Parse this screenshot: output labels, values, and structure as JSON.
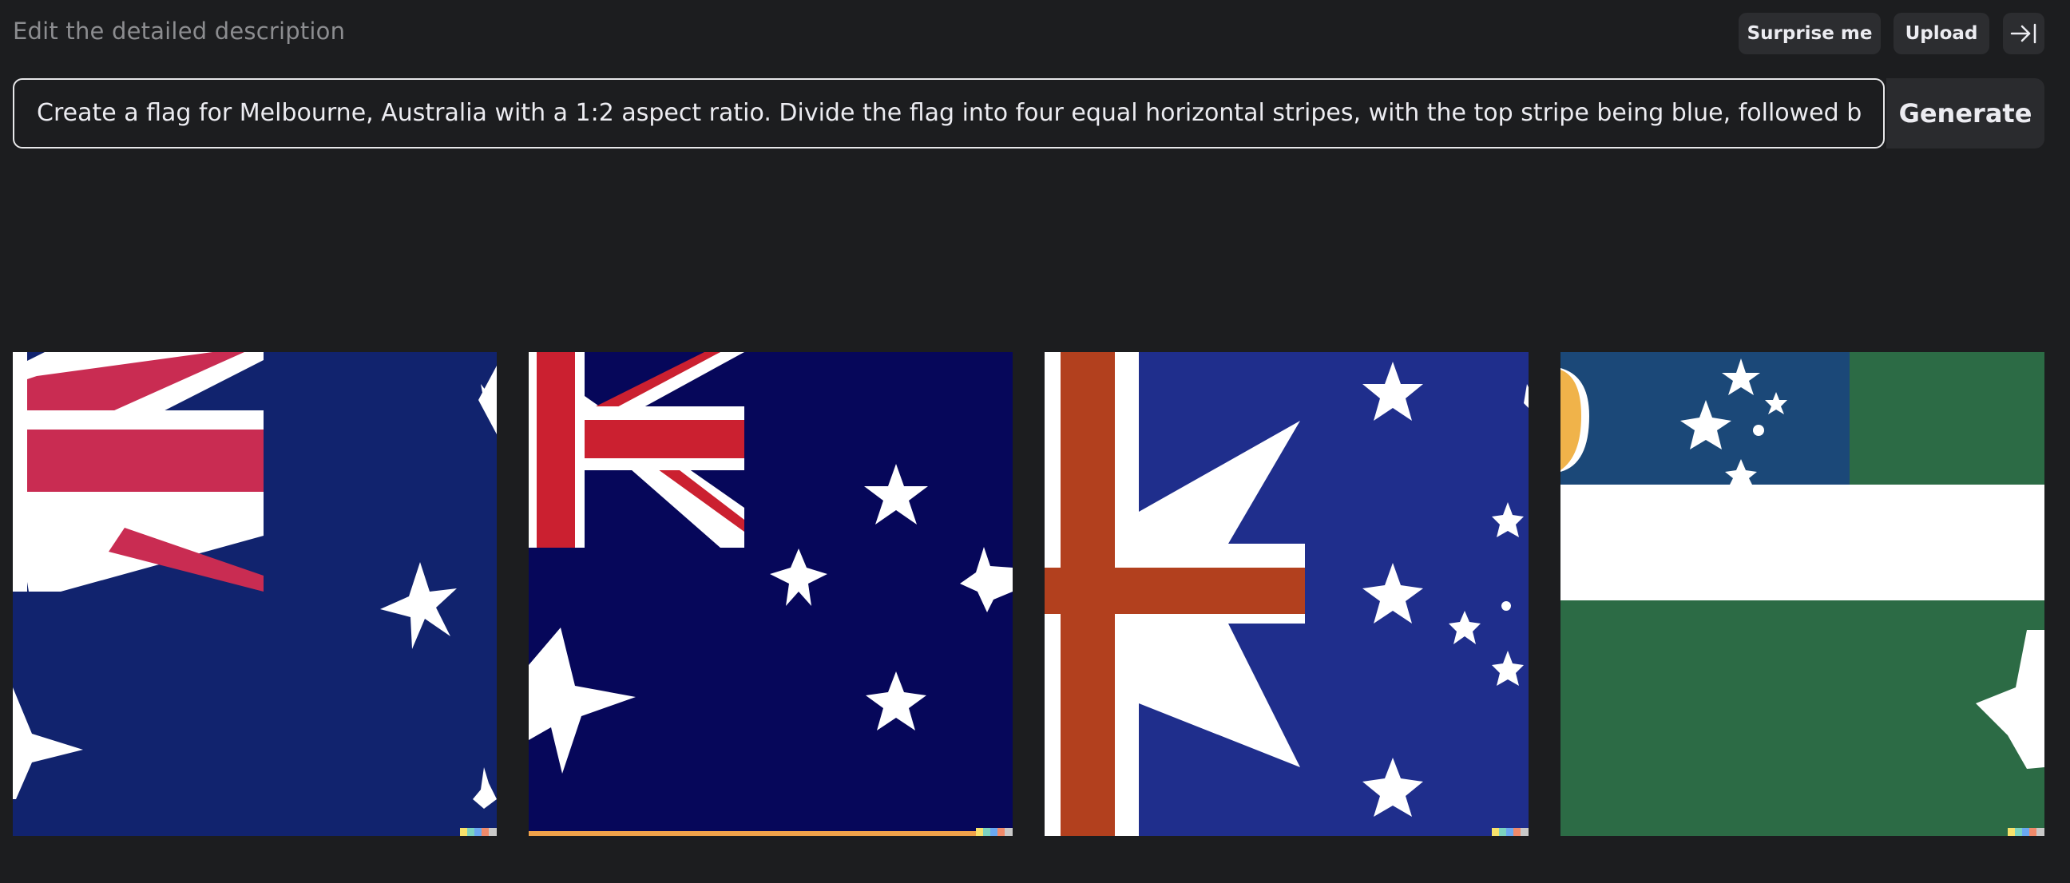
{
  "header": {
    "title": "Edit the detailed description",
    "surprise_label": "Surprise me",
    "upload_label": "Upload",
    "collapse_icon": "collapse-sidebar-icon"
  },
  "prompt": {
    "value": "Create a flag for Melbourne, Australia with a 1:2 aspect ratio. Divide the flag into four equal horizontal stripes, with the top stripe being blue, followed by white, green, and",
    "generate_label": "Generate"
  },
  "results": {
    "images": [
      {
        "alt": "flag-variation-1"
      },
      {
        "alt": "flag-variation-2"
      },
      {
        "alt": "flag-variation-3"
      },
      {
        "alt": "flag-variation-4"
      }
    ]
  },
  "colors": {
    "background": "#1c1d1f",
    "button_bg": "#2c2d30",
    "text": "#ececf1",
    "muted": "#8c8d90"
  }
}
